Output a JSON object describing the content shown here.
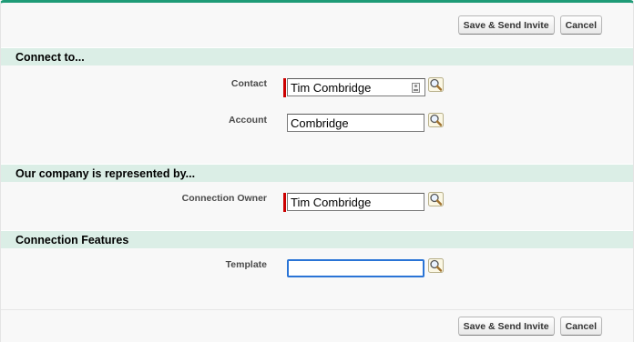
{
  "buttons": {
    "save_send": "Save & Send Invite",
    "cancel": "Cancel"
  },
  "sections": {
    "connect_to": {
      "title": "Connect to...",
      "contact": {
        "label": "Contact",
        "value": "Tim Combridge",
        "required": true
      },
      "account": {
        "label": "Account",
        "value": "Combridge"
      }
    },
    "represented_by": {
      "title": "Our company is represented by...",
      "owner": {
        "label": "Connection Owner",
        "value": "Tim Combridge",
        "required": true
      }
    },
    "features": {
      "title": "Connection Features",
      "template": {
        "label": "Template",
        "value": ""
      }
    }
  },
  "colors": {
    "section_bg": "#dbeee6",
    "accent_top": "#1f9b77",
    "required": "#cc0000",
    "focus": "#2a74d6"
  },
  "icons": {
    "lookup": "magnifier-lookup-icon",
    "contact_card": "contact-card-icon"
  }
}
